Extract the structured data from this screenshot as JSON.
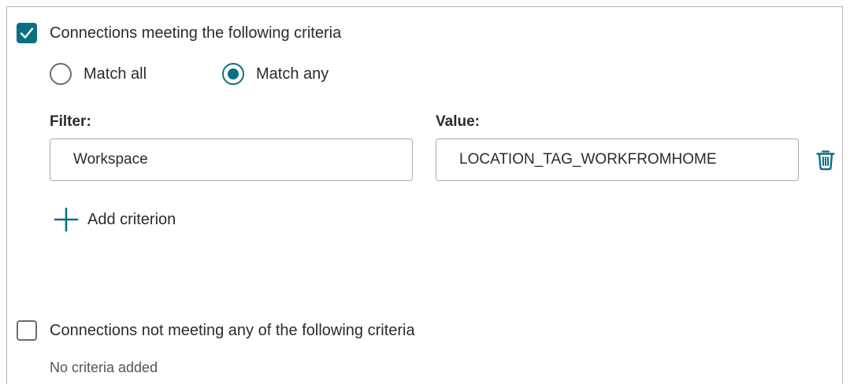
{
  "section_meeting": {
    "checkbox_label": "Connections meeting the following criteria",
    "checked": true,
    "match_mode": {
      "options": [
        {
          "label": "Match all",
          "selected": false
        },
        {
          "label": "Match any",
          "selected": true
        }
      ]
    },
    "filter": {
      "label": "Filter:",
      "value": "Workspace"
    },
    "value": {
      "label": "Value:",
      "value": "LOCATION_TAG_WORKFROMHOME"
    },
    "delete_icon": "trash-icon",
    "add_criterion_label": "Add criterion",
    "add_icon": "plus-icon"
  },
  "section_not_meeting": {
    "checkbox_label": "Connections not meeting any of the following criteria",
    "checked": false,
    "empty_text": "No criteria added"
  },
  "colors": {
    "accent": "#0b6f83",
    "border": "#a9a9a9",
    "text": "#2b2b2b"
  }
}
